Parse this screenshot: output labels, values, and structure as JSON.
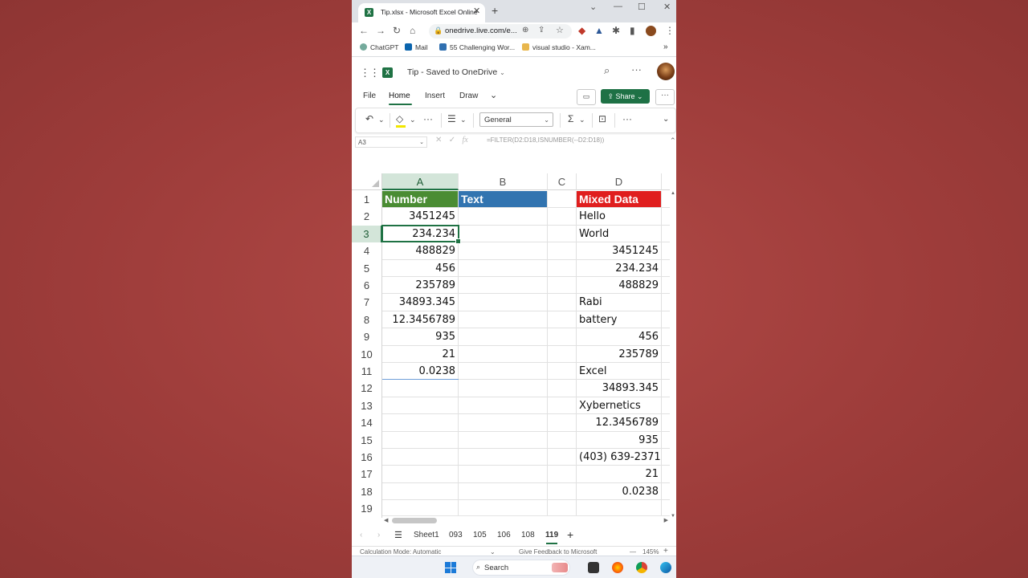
{
  "browser": {
    "tab_title": "Tip.xlsx - Microsoft Excel Online",
    "url": "onedrive.live.com/e...",
    "bookmarks": [
      {
        "label": "ChatGPT"
      },
      {
        "label": "Mail"
      },
      {
        "label": "55 Challenging Wor..."
      },
      {
        "label": "visual studio - Xam..."
      }
    ]
  },
  "excel": {
    "doc_title": "Tip  -  Saved to OneDrive",
    "ribbon_tabs": [
      "File",
      "Home",
      "Insert",
      "Draw"
    ],
    "active_ribbon_tab": "Home",
    "share_label": "Share",
    "number_format": "General",
    "name_box": "A3",
    "formula": "=FILTER(D2:D18,ISNUMBER(--D2:D18))"
  },
  "grid": {
    "columns": [
      "A",
      "B",
      "C",
      "D"
    ],
    "rows": [
      "1",
      "2",
      "3",
      "4",
      "5",
      "6",
      "7",
      "8",
      "9",
      "10",
      "11",
      "12",
      "13",
      "14",
      "15",
      "16",
      "17",
      "18",
      "19"
    ],
    "headers": {
      "A1": "Number",
      "B1": "Text",
      "D1": "Mixed Data"
    },
    "header_colors": {
      "A1": "#4a8c33",
      "B1": "#3274b0",
      "D1": "#e01e1e"
    },
    "col_a": [
      "3451245",
      "234.234",
      "488829",
      "456",
      "235789",
      "34893.345",
      "12.3456789",
      "935",
      "21",
      "0.0238"
    ],
    "col_d": [
      {
        "v": "Hello",
        "t": "txt"
      },
      {
        "v": "World",
        "t": "txt"
      },
      {
        "v": "3451245",
        "t": "num"
      },
      {
        "v": "234.234",
        "t": "num"
      },
      {
        "v": "488829",
        "t": "num"
      },
      {
        "v": "Rabi",
        "t": "txt"
      },
      {
        "v": "battery",
        "t": "txt"
      },
      {
        "v": "456",
        "t": "num"
      },
      {
        "v": "235789",
        "t": "num"
      },
      {
        "v": "Excel",
        "t": "txt"
      },
      {
        "v": "34893.345",
        "t": "num"
      },
      {
        "v": "Xybernetics",
        "t": "txt"
      },
      {
        "v": "12.3456789",
        "t": "num"
      },
      {
        "v": "935",
        "t": "num"
      },
      {
        "v": "(403) 639-2371",
        "t": "txt"
      },
      {
        "v": "21",
        "t": "num"
      },
      {
        "v": "0.0238",
        "t": "num"
      }
    ],
    "active_cell": "A3"
  },
  "sheets": [
    "Sheet1",
    "093",
    "105",
    "106",
    "108",
    "119"
  ],
  "active_sheet": "119",
  "status": {
    "calc_mode": "Calculation Mode: Automatic",
    "feedback": "Give Feedback to Microsoft",
    "zoom": "145%"
  },
  "taskbar": {
    "search_label": "Search"
  }
}
